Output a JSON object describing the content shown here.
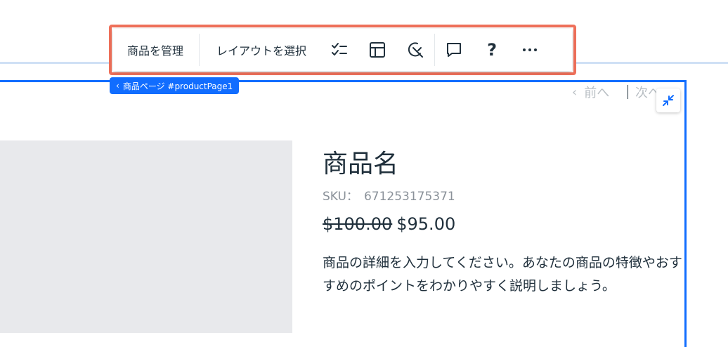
{
  "toolbar": {
    "manage_label": "商品を管理",
    "layout_label": "レイアウトを選択",
    "icons": [
      "checklist-icon",
      "layout-icon",
      "design-icon",
      "comment-icon",
      "help-icon",
      "more-icon"
    ],
    "help_glyph": "?",
    "border_color": "#ef705a"
  },
  "page_tag": {
    "chevron": "‹",
    "label": "商品ページ #productPage1",
    "color": "#116dff"
  },
  "nav": {
    "prev_chevron": "‹",
    "prev_label": "前へ",
    "next_label": "次へ",
    "next_chevron": "›"
  },
  "product": {
    "name": "商品名",
    "sku_label": "SKU：",
    "sku_value": "671253175371",
    "price_original": "$100.00",
    "price_sale": "$95.00",
    "description": "商品の詳細を入力してください。あなたの商品の特徴やおすすめのポイントをわかりやすく説明しましょう。"
  }
}
